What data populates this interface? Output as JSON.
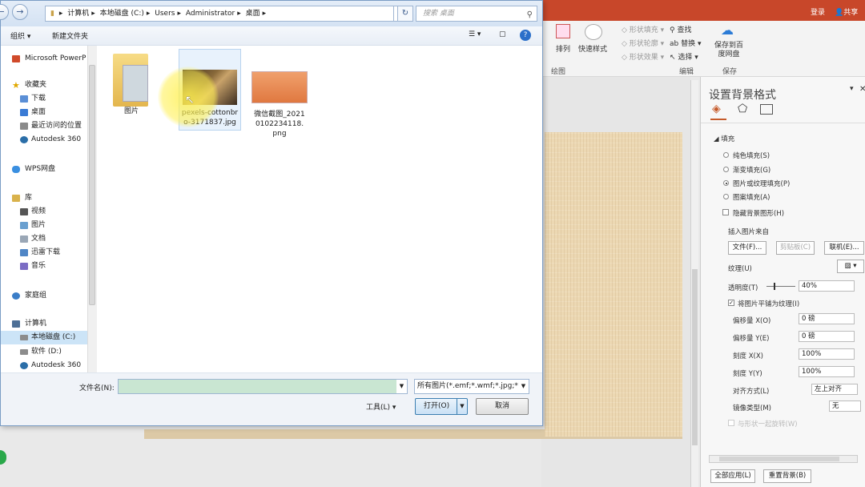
{
  "ppt": {
    "title_right": [
      "登录",
      "共享"
    ],
    "ribbon": {
      "arrange": "排列",
      "quick_styles": "快速样式",
      "shape_fill": "形状填充",
      "shape_outline": "形状轮廓",
      "shape_effects": "形状效果",
      "find": "查找",
      "replace": "替换",
      "select": "选择",
      "save_baidu": "保存到百度网盘",
      "group_drawing": "绘图",
      "group_editing": "编辑",
      "group_save": "保存"
    }
  },
  "pane": {
    "title": "设置背景格式",
    "section_fill": "填充",
    "fill_options": [
      {
        "label": "纯色填充(S)",
        "selected": false
      },
      {
        "label": "渐变填充(G)",
        "selected": false
      },
      {
        "label": "图片或纹理填充(P)",
        "selected": true
      },
      {
        "label": "图案填充(A)",
        "selected": false
      }
    ],
    "hide_bg_graphics": "隐藏背景图形(H)",
    "insert_from": "插入图片来自",
    "btn_file": "文件(F)...",
    "btn_clipboard": "剪贴板(C)",
    "btn_online": "联机(E)...",
    "texture": "纹理(U)",
    "transparency": "透明度(T)",
    "transparency_value": "40%",
    "tile_picture": "将图片平铺为纹理(I)",
    "offset_x": "偏移量 X(O)",
    "offset_x_value": "0 磅",
    "offset_y": "偏移量 Y(E)",
    "offset_y_value": "0 磅",
    "scale_x": "刻度 X(X)",
    "scale_x_value": "100%",
    "scale_y": "刻度 Y(Y)",
    "scale_y_value": "100%",
    "alignment": "对齐方式(L)",
    "alignment_value": "左上对齐",
    "mirror_type": "镜像类型(M)",
    "mirror_value": "无",
    "rotate_with_shape": "与形状一起旋转(W)",
    "btn_apply_all": "全部应用(L)",
    "btn_reset": "重置背景(B)"
  },
  "dialog": {
    "address": [
      "计算机",
      "本地磁盘 (C:)",
      "Users",
      "Administrator",
      "桌面"
    ],
    "search_placeholder": "搜索 桌面",
    "organize": "组织",
    "new_folder": "新建文件夹",
    "nav_items": [
      {
        "label": "Microsoft PowerP",
        "icon": "powerpoint-icon"
      },
      {
        "label": "收藏夹",
        "icon": "star-icon"
      },
      {
        "label": "下载",
        "icon": "download-folder-icon"
      },
      {
        "label": "桌面",
        "icon": "desktop-icon"
      },
      {
        "label": "最近访问的位置",
        "icon": "recent-places-icon"
      },
      {
        "label": "Autodesk 360",
        "icon": "autodesk-icon"
      },
      {
        "label": "WPS网盘",
        "icon": "cloud-icon"
      },
      {
        "label": "库",
        "icon": "library-icon"
      },
      {
        "label": "视频",
        "icon": "video-icon"
      },
      {
        "label": "图片",
        "icon": "pictures-icon"
      },
      {
        "label": "文档",
        "icon": "documents-icon"
      },
      {
        "label": "迅雷下载",
        "icon": "thunder-icon"
      },
      {
        "label": "音乐",
        "icon": "music-icon"
      },
      {
        "label": "家庭组",
        "icon": "homegroup-icon"
      },
      {
        "label": "计算机",
        "icon": "computer-icon"
      },
      {
        "label": "本地磁盘 (C:)",
        "icon": "drive-icon"
      },
      {
        "label": "软件 (D:)",
        "icon": "drive-icon"
      },
      {
        "label": "Autodesk 360",
        "icon": "autodesk-icon"
      }
    ],
    "files": [
      {
        "name": "图片",
        "type": "folder"
      },
      {
        "name": "pexels-cottonbro-3171837.jpg",
        "type": "image"
      },
      {
        "name": "微信截图_20210102234118.png",
        "type": "image"
      }
    ],
    "filename_label": "文件名(N):",
    "filename_value": "",
    "filetype": "所有图片(*.emf;*.wmf;*.jpg;*.jp",
    "tools": "工具(L)",
    "open": "打开(O)",
    "cancel": "取消"
  }
}
